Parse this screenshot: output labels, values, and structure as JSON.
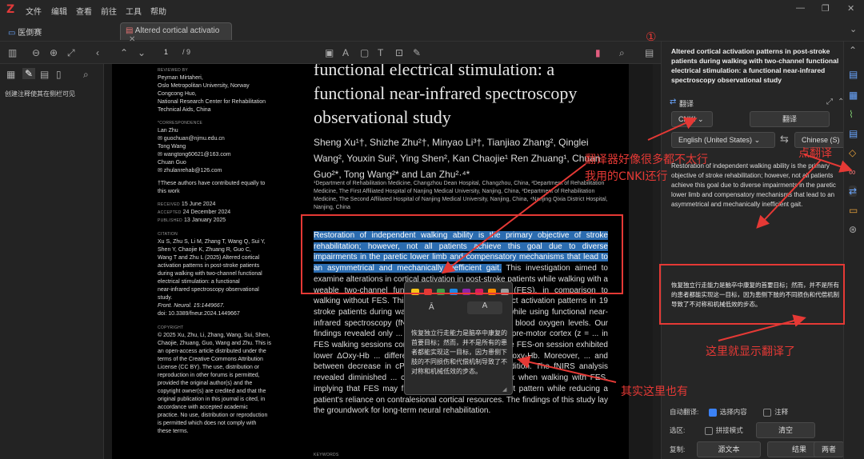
{
  "app": {
    "logo": "Z"
  },
  "menu": [
    "文件",
    "编辑",
    "查看",
    "前往",
    "工具",
    "帮助"
  ],
  "tabs": {
    "library": "医倒赛",
    "document": "Altered cortical activatio"
  },
  "toolbar": {
    "page_current": "1",
    "page_total": "/ 9"
  },
  "sidebar": {
    "hint": "创建注释使其在侧栏可见"
  },
  "paper": {
    "reviewed_label": "REVIEWED BY",
    "reviewers": [
      "Peyman Mirtaheri,",
      "Oslo Metropolitan University, Norway",
      "Congcong Huo,",
      "National Research Center for Rehabilitation",
      "Technical Aids, China"
    ],
    "corr_label": "*CORRESPONDENCE",
    "corr": [
      "Lan Zhu",
      "✉ guochuan@njmu.edu.cn",
      "Tong Wang",
      "✉ wangtong60621@163.com",
      "Chuan Guo",
      "✉ zhulanrehab@126.com"
    ],
    "equal": [
      "†These authors have contributed equally to",
      "this work"
    ],
    "dates": [
      [
        "RECEIVED",
        "15 June 2024"
      ],
      [
        "ACCEPTED",
        "24 December 2024"
      ],
      [
        "PUBLISHED",
        "13 January 2025"
      ]
    ],
    "citation_label": "CITATION",
    "citation": [
      "Xu S, Zhu S, Li M, Zhang T, Wang Q, Sui Y,",
      "Shen Y, Chaojie K, Zhuang R, Guo C,",
      "Wang T and Zhu L (2025) Altered cortical",
      "activation patterns in post-stroke patients",
      "during walking with two-channel functional",
      "electrical stimulation: a functional",
      "near-infrared spectroscopy observational",
      "study.",
      "Front. Neurol. 15:1449667.",
      "doi: 10.3389/fneur.2024.1449667"
    ],
    "copyright_label": "COPYRIGHT",
    "copyright": [
      "© 2025 Xu, Zhu, Li, Zhang, Wang, Sui, Shen,",
      "Chaojie, Zhuang, Guo, Wang and Zhu. This is",
      "an open-access article distributed under the",
      "terms of the Creative Commons Attribution",
      "License (CC BY). The use, distribution or",
      "reproduction in other forums is permitted,",
      "provided the original author(s) and the",
      "copyright owner(s) are credited and that the",
      "original publication in this journal is cited, in",
      "accordance with accepted academic",
      "practice. No use, distribution or reproduction",
      "is permitted which does not comply with",
      "these terms."
    ],
    "keywords_label": "KEYWORDS",
    "title": "functional electrical stimulation: a functional near-infrared spectroscopy observational study",
    "authors": "Sheng Xu¹†, Shizhe Zhu²†, Minyao Li³†, Tianjiao Zhang², Qinglei Wang², Youxin Sui², Ying Shen², Kan Chaojie¹ Ren Zhuang¹, Chuan Guo²*, Tong Wang²* and Lan Zhu²·⁴*",
    "affil": "¹Department of Rehabilitation Medicine, Changzhou Dean Hospital, Changzhou, China, ²Department of Rehabilitation Medicine, The First Affiliated Hospital of Nanjing Medical University, Nanjing, China, ³Department of Rehabilitation Medicine, The Second Affiliated Hospital of Nanjing Medical University, Nanjing, China, ⁴Nanjing Qixia District Hospital, Nanjing, China",
    "abstract_hl": "Restoration of independent walking ability is the primary objective of stroke rehabilitation; however, not all patients achieve this goal due to diverse impairments in the paretic lower limb and compensatory mechanisms that lead to an asymmetrical and mechanically inefficient gait.",
    "abstract_rest": " This investigation aimed to examine alterations in cortical activation in post-stroke patients while walking with a weable two-channel functional electrical stimulation (FES), in comparison to walking without FES. This observational study ... distinct activation patterns in 19 stroke patients during walking with and without FES, while using functional near-infrared spectroscopy (fNIRS) to measure changes in blood oxygen levels. Our findings revealed only ... Oxy-Hb in the contralesional pre-motor cortex (z = ... in FES walking sessions compared to the FES-off ... in the FES-on session exhibited lower ΔOxy-Hb ... differences were observed in ΔDeoxy-Hb. Moreover, ... and between decrease in cPMC and the reduced ... condition. The fNIRS analysis revealed diminished ... contralesional pre-motor cortex when walking with FES, implying that FES may facilitate a more automatic gait pattern while reducing a patient's reliance on contralesional cortical resources. The findings of this study lay the groundwork for long-term neural rehabilitation."
  },
  "popup": {
    "translation": "恢复独立行走能力是脑卒中康复的首要目标；然而，并不是所有的患者都能实现这一目标，因为患侧下肢的不同损伤和代偿机制导致了不对称和机械低效的步态。"
  },
  "panel": {
    "doc_title": "Altered cortical activation patterns in post-stroke patients during walking with two-channel functional electrical stimulation: a functional near-infrared spectroscopy observational study",
    "section_label": "翻译",
    "engine": "CNKI",
    "translate_btn": "翻译",
    "source_lang": "English (United States)",
    "target_lang": "Chinese (S)",
    "source_text": "Restoration of independent walking ability is the primary objective of stroke rehabilitation; however, not all patients achieve this goal due to diverse impairments in the paretic lower limb and compensatory mechanisms that lead to an asymmetrical and mechanically inefficient gait.",
    "target_text": "恢复独立行走能力是脑卒中康复的首要目标；然而，并不是所有的患者都能实现这一目标，因为患侧下肢的不同损伤和代偿机制导致了不对称和机械低效的步态。",
    "auto_label": "自动翻译:",
    "opt_select": "选择内容",
    "opt_note": "注释",
    "sel_label": "选区:",
    "opt_concat": "拼接模式",
    "clear_btn": "清空",
    "copy_label": "复制:",
    "copy_src": "源文本",
    "copy_res": "结果",
    "copy_both": "两者"
  },
  "annotations": {
    "circle_one": "①",
    "note1": "翻译器好像很多都不太行",
    "note2": "我用的CNKI还行",
    "note3": "点翻译",
    "note4": "这里就显示翻译了",
    "note5": "其实这里也有"
  },
  "colors": {
    "highlight": "#2b6cb0",
    "annotation": "#e53935",
    "accent": "#3b82f6"
  }
}
